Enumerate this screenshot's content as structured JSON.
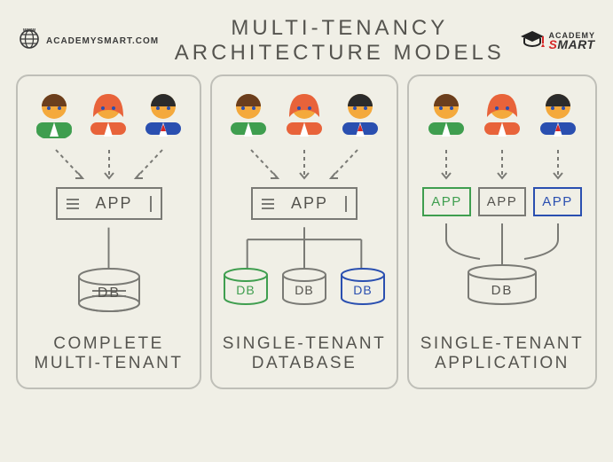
{
  "header": {
    "url": "ACADEMYSMART.COM",
    "title": "MULTI-TENANCY ARCHITECTURE MODELS",
    "logo_top": "ACADEMY",
    "logo_bottom_red": "S",
    "logo_bottom_rest": "MART"
  },
  "labels": {
    "app": "APP",
    "db": "DB"
  },
  "panels": [
    {
      "title": "COMPLETE\nMULTI-TENANT",
      "apps": 1,
      "dbs": 1,
      "app_colors": [
        "grey"
      ],
      "db_colors": [
        "grey"
      ]
    },
    {
      "title": "SINGLE-TENANT\nDATABASE",
      "apps": 1,
      "dbs": 3,
      "app_colors": [
        "grey"
      ],
      "db_colors": [
        "green",
        "grey",
        "blue"
      ]
    },
    {
      "title": "SINGLE-TENANT\nAPPLICATION",
      "apps": 3,
      "dbs": 1,
      "app_colors": [
        "green",
        "grey",
        "blue"
      ],
      "db_colors": [
        "grey"
      ]
    }
  ]
}
